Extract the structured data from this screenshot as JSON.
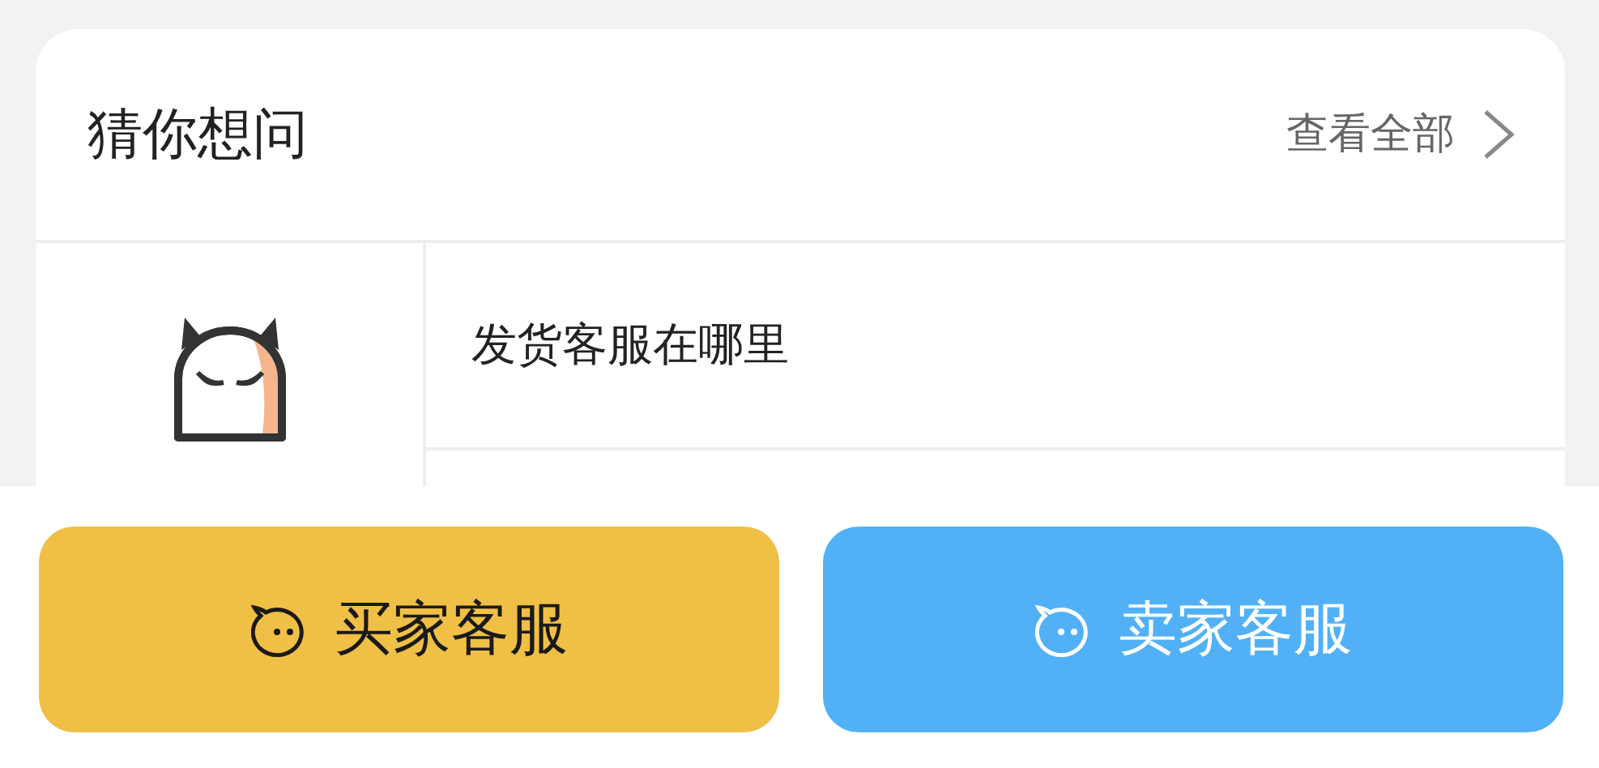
{
  "section": {
    "title": "猜你想问",
    "view_all": "查看全部"
  },
  "questions": [
    {
      "text": "发货客服在哪里"
    }
  ],
  "buttons": [
    {
      "label": "买家客服",
      "kind": "dark",
      "color": "#f0bf45"
    },
    {
      "label": "卖家客服",
      "kind": "light",
      "color": "#52b1f6"
    }
  ]
}
